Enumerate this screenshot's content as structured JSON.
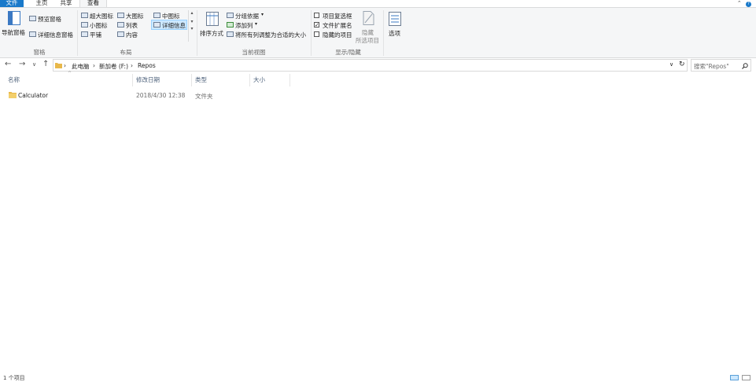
{
  "tabs": [
    {
      "label": "文件"
    },
    {
      "label": "主页"
    },
    {
      "label": "共享"
    },
    {
      "label": "查看"
    }
  ],
  "ribbon": {
    "panes": {
      "label": "窗格",
      "nav_pane": "导航窗格",
      "preview_pane": "预览窗格",
      "details_pane": "详细信息窗格"
    },
    "layout": {
      "label": "布局",
      "extra_large": "超大图标",
      "large": "大图标",
      "medium": "中图标",
      "small": "小图标",
      "list": "列表",
      "details": "详细信息",
      "tiles": "平铺",
      "content": "内容"
    },
    "current_view": {
      "label": "当前视图",
      "sort_by": "排序方式",
      "group_by": "分组依据",
      "add_columns": "添加列",
      "size_all_columns": "将所有列调整为合适的大小"
    },
    "show_hide": {
      "label": "显示/隐藏",
      "item_checkboxes": "项目复选框",
      "item_checkboxes_checked": false,
      "file_extensions": "文件扩展名",
      "file_extensions_checked": true,
      "hidden_items": "隐藏的项目",
      "hidden_items_checked": false,
      "hide_selected_1": "隐藏",
      "hide_selected_2": "所选项目"
    },
    "options": "选项"
  },
  "address": {
    "crumbs": [
      "此电脑",
      "新加卷 (F:)",
      "Repos"
    ],
    "search_placeholder": "搜索\"Repos\""
  },
  "columns": [
    "名称",
    "修改日期",
    "类型",
    "大小"
  ],
  "files": [
    {
      "name": "Calculator",
      "modified": "2018/4/30 12:38",
      "type": "文件夹",
      "size": ""
    }
  ],
  "status": {
    "text": "1 个项目"
  },
  "colors": {
    "accent": "#1979ca",
    "folder": "#e8b84a",
    "selection": "#cce8ff"
  }
}
